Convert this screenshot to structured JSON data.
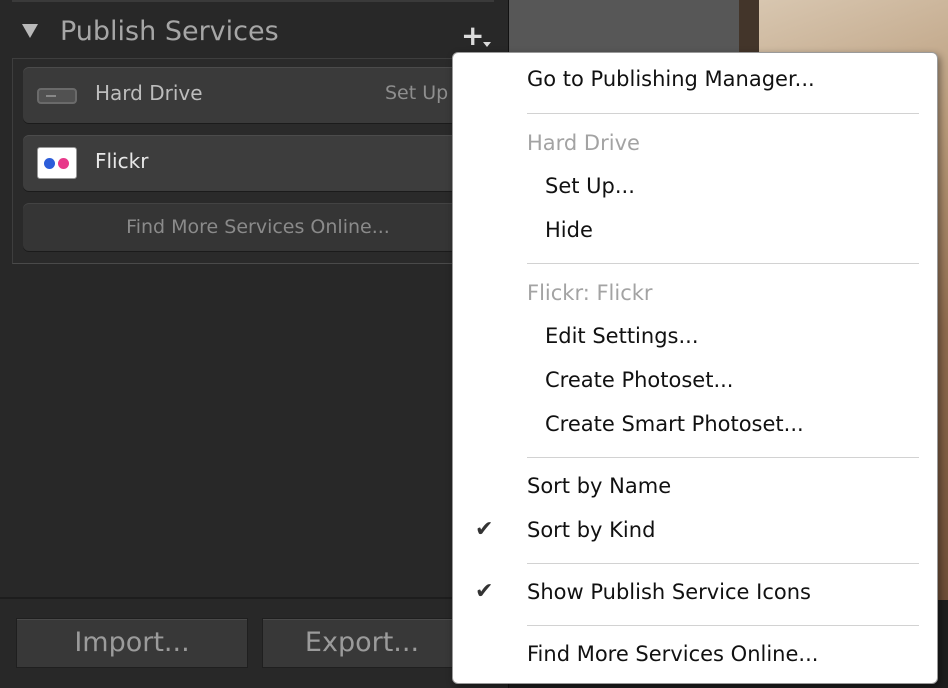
{
  "panel": {
    "title": "Publish Services",
    "services": [
      {
        "name": "Hard Drive",
        "action": "Set Up"
      },
      {
        "name": "Flickr"
      }
    ],
    "find_more_label": "Find More Services Online...",
    "import_label": "Import...",
    "export_label": "Export..."
  },
  "menu": {
    "goto_manager": "Go to Publishing Manager...",
    "hard_drive_header": "Hard Drive",
    "setup": "Set Up...",
    "hide": "Hide",
    "flickr_header": "Flickr: Flickr",
    "edit_settings": "Edit Settings...",
    "create_photoset": "Create Photoset...",
    "create_smart_photoset": "Create Smart Photoset...",
    "sort_by_name": "Sort by Name",
    "sort_by_kind": "Sort by Kind",
    "show_icons": "Show Publish Service Icons",
    "find_more": "Find More Services Online...",
    "checked_items": [
      "Sort by Kind",
      "Show Publish Service Icons"
    ],
    "check_glyph": "✔"
  },
  "colors": {
    "panel_bg": "#282828",
    "menu_bg": "#ffffff",
    "disabled_text": "#a3a3a3",
    "flickr_blue": "#2c5dd9",
    "flickr_pink": "#e8398a"
  }
}
